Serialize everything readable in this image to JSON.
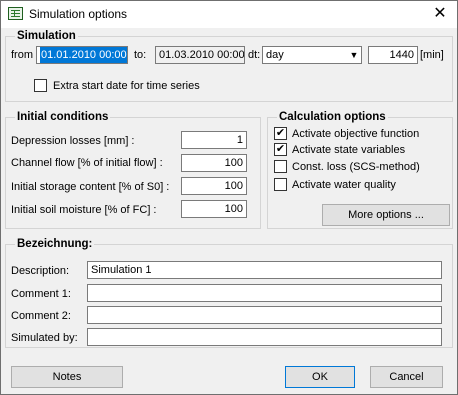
{
  "window": {
    "title": "Simulation options",
    "close_glyph": "✕"
  },
  "simulation": {
    "title": "Simulation",
    "from_label": "from",
    "from_value": "01.01.2010 00:00",
    "to_label": "to:",
    "to_value": "01.03.2010 00:00",
    "dt_label": "dt:",
    "dt_value": "day",
    "dt_arrow": "▼",
    "minutes_value": "1440",
    "minutes_unit": "[min]",
    "extra_start_label": "Extra start date for time series",
    "extra_start_checked": false
  },
  "initial_conditions": {
    "title": "Initial conditions",
    "rows": [
      {
        "label": "Depression losses [mm] :",
        "value": "1"
      },
      {
        "label": "Channel flow [% of initial flow] :",
        "value": "100"
      },
      {
        "label": "Initial storage content [% of S0] :",
        "value": "100"
      },
      {
        "label": "Initial soil moisture [% of FC] :",
        "value": "100"
      }
    ]
  },
  "calculation_options": {
    "title": "Calculation options",
    "items": [
      {
        "label": "Activate objective function",
        "checked": "✔"
      },
      {
        "label": "Activate state variables",
        "checked": "✔"
      },
      {
        "label": "Const. loss (SCS-method)",
        "checked": ""
      },
      {
        "label": "Activate water quality",
        "checked": ""
      }
    ],
    "more_options_label": "More options ..."
  },
  "bezeichnung": {
    "title": "Bezeichnung:",
    "description_label": "Description:",
    "description_value": "Simulation 1",
    "comment1_label": "Comment 1:",
    "comment1_value": "",
    "comment2_label": "Comment 2:",
    "comment2_value": "",
    "simulated_by_label": "Simulated by:",
    "simulated_by_value": ""
  },
  "footer": {
    "notes_label": "Notes",
    "ok_label": "OK",
    "cancel_label": "Cancel"
  }
}
